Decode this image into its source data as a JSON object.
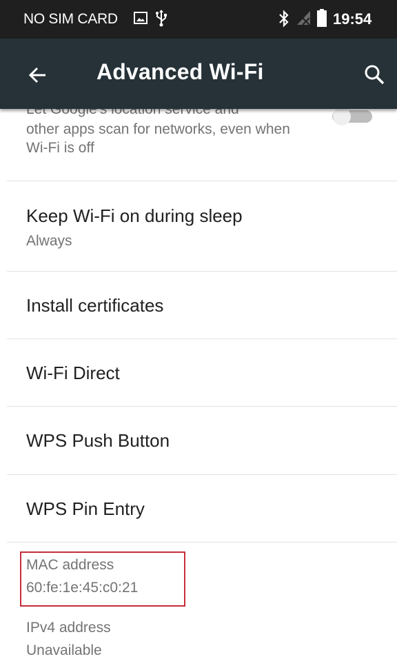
{
  "status_bar": {
    "carrier": "NO SIM CARD",
    "time": "19:54",
    "icons": [
      "image-notification-icon",
      "usb-icon",
      "bluetooth-icon",
      "no-signal-icon",
      "battery-icon"
    ]
  },
  "app_bar": {
    "title": "Advanced Wi-Fi",
    "background": "#263238",
    "icons": [
      "back-arrow-icon",
      "search-icon"
    ]
  },
  "settings": {
    "scanning": {
      "cut_line": "Let Google's location service and",
      "description": "other apps scan for networks, even when Wi-Fi is off",
      "toggle_on": false
    },
    "keep_wifi_on": {
      "title": "Keep Wi-Fi on during sleep",
      "value": "Always"
    },
    "install_certificates": {
      "title": "Install certificates"
    },
    "wifi_direct": {
      "title": "Wi-Fi Direct"
    },
    "wps_push": {
      "title": "WPS Push Button"
    },
    "wps_pin": {
      "title": "WPS Pin Entry"
    },
    "mac_address": {
      "label": "MAC address",
      "value": "60:fe:1e:45:c0:21"
    },
    "ipv4_address": {
      "label": "IPv4 address",
      "value": "Unavailable"
    }
  },
  "colors": {
    "highlight": "#c62d3a",
    "divider": "#e2e2e2"
  }
}
